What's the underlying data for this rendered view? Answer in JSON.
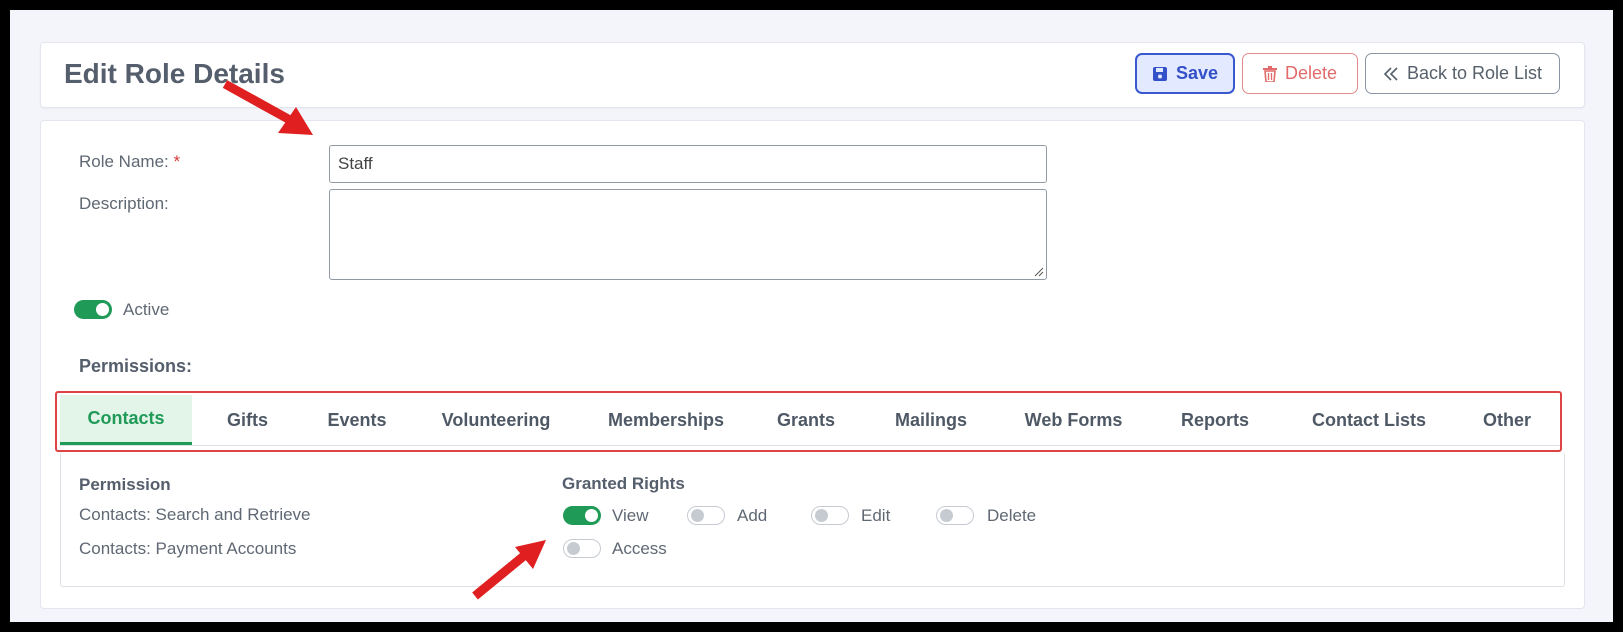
{
  "page": {
    "title": "Edit Role Details"
  },
  "toolbar": {
    "save_label": "Save",
    "delete_label": "Delete",
    "back_label": "Back to Role List"
  },
  "form": {
    "role_name_label": "Role Name:",
    "role_name_required": "*",
    "role_name_value": "Staff",
    "description_label": "Description:",
    "description_value": "",
    "active_label": "Active",
    "active": true
  },
  "permissions": {
    "title": "Permissions:",
    "tabs": [
      {
        "label": "Contacts",
        "active": true
      },
      {
        "label": "Gifts",
        "active": false
      },
      {
        "label": "Events",
        "active": false
      },
      {
        "label": "Volunteering",
        "active": false
      },
      {
        "label": "Memberships",
        "active": false
      },
      {
        "label": "Grants",
        "active": false
      },
      {
        "label": "Mailings",
        "active": false
      },
      {
        "label": "Web Forms",
        "active": false
      },
      {
        "label": "Reports",
        "active": false
      },
      {
        "label": "Contact Lists",
        "active": false
      },
      {
        "label": "Other",
        "active": false
      }
    ],
    "col_permission": "Permission",
    "col_rights": "Granted Rights",
    "rows": [
      {
        "name": "Contacts: Search and Retrieve",
        "rights": [
          {
            "label": "View",
            "on": true
          },
          {
            "label": "Add",
            "on": false
          },
          {
            "label": "Edit",
            "on": false
          },
          {
            "label": "Delete",
            "on": false
          }
        ]
      },
      {
        "name": "Contacts: Payment Accounts",
        "rights": [
          {
            "label": "Access",
            "on": false
          }
        ]
      }
    ]
  },
  "colors": {
    "accent": "#1f9a57",
    "primary": "#3350c8",
    "danger": "#e26a6a",
    "annotation": "#e02020"
  },
  "icons": {
    "save": "floppy-disk-icon",
    "delete": "trash-icon",
    "back": "double-chevron-left-icon"
  }
}
